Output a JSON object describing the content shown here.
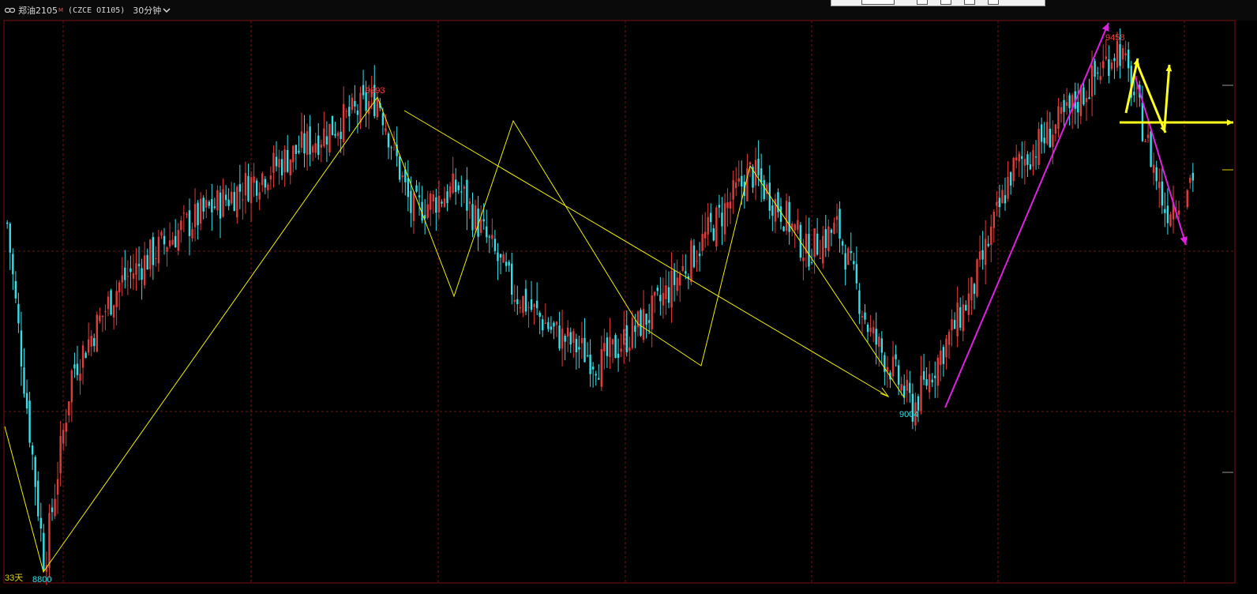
{
  "window": {
    "symbol": "郑油2105",
    "symbol_superscript": "M",
    "contract_code": "(CZCE OI105)",
    "period": "30分钟",
    "period_icon": "chevron-down-icon",
    "link_icon": "link-icon"
  },
  "colors": {
    "background": "#000000",
    "up": "#e03c3c",
    "down": "#33e0e8",
    "grid": "#7a1010",
    "trend_line": "#f0f000",
    "magenta_arrow": "#e020e0",
    "yellow_arrow": "#ffff20",
    "high_label": "#ff3d3d",
    "low_label": "#33e0e8",
    "day_label": "#e0d000"
  },
  "chart_data": {
    "type": "candlestick",
    "annotations": {
      "low_left": "8800",
      "high_mid": "9393",
      "low_right": "9004",
      "high_right": "9458",
      "days_label": "33天"
    },
    "price_range_visible": [
      8800,
      9458
    ],
    "waypoints_close": [
      9235,
      9140,
      8810,
      9050,
      9160,
      9230,
      9393,
      9250,
      9280,
      9150,
      9100,
      9060,
      9130,
      9300,
      9250,
      9200,
      9230,
      9100,
      9050,
      9004,
      9150,
      9300,
      9370,
      9458,
      9380,
      9250,
      9300
    ]
  }
}
